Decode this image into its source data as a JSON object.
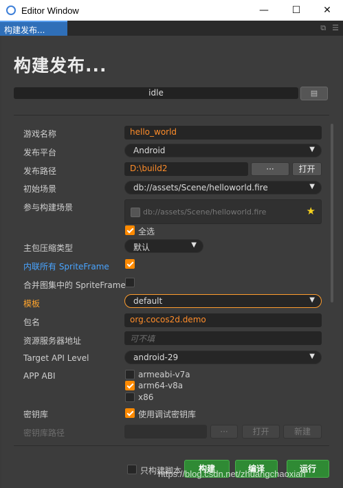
{
  "window": {
    "title": "Editor Window",
    "minimize": "—",
    "maximize": "☐",
    "close": "✕"
  },
  "tab": {
    "label": "构建发布...",
    "icons": [
      "⧉",
      "☰"
    ]
  },
  "panel": {
    "heading": "构建发布...",
    "status": "idle",
    "log_button": "▤"
  },
  "form": {
    "game_name": {
      "label": "游戏名称",
      "value": "hello_world"
    },
    "platform": {
      "label": "发布平台",
      "value": "Android"
    },
    "build_path": {
      "label": "发布路径",
      "value": "D:\\build2",
      "browse": "···",
      "open": "打开"
    },
    "start_scene": {
      "label": "初始场景",
      "value": "db://assets/Scene/helloworld.fire"
    },
    "included_scenes": {
      "label": "参与构建场景",
      "scene": "db://assets/Scene/helloworld.fire",
      "select_all": "全选"
    },
    "compression": {
      "label": "主包压缩类型",
      "value": "默认"
    },
    "inline_sprites": {
      "label": "内联所有 SpriteFrame"
    },
    "merge_atlas": {
      "label": "合并图集中的 SpriteFrame"
    },
    "template": {
      "label": "模板",
      "value": "default"
    },
    "package": {
      "label": "包名",
      "value": "org.cocos2d.demo"
    },
    "resource_server": {
      "label": "资源服务器地址",
      "placeholder": "可不填"
    },
    "api_level": {
      "label": "Target API Level",
      "value": "android-29"
    },
    "abi": {
      "label": "APP ABI",
      "options": [
        "armeabi-v7a",
        "arm64-v8a",
        "x86"
      ]
    },
    "keystore": {
      "label": "密钥库",
      "use_debug": "使用调试密钥库"
    },
    "keystore_path": {
      "label": "密钥库路径",
      "browse": "···",
      "open": "打开",
      "new": "新建"
    }
  },
  "footer": {
    "script_only": "只构建脚本",
    "build": "构建",
    "compile": "编译",
    "run": "运行"
  },
  "watermark": "https://blog.csdn.net/zhuangchaoxian"
}
